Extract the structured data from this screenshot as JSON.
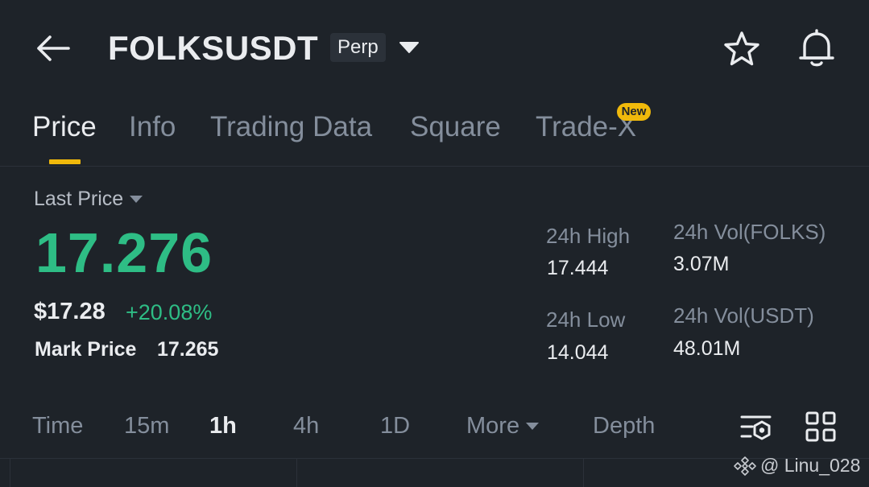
{
  "header": {
    "symbol": "FOLKSUSDT",
    "contract_type": "Perp"
  },
  "tabs": [
    {
      "label": "Price",
      "active": true
    },
    {
      "label": "Info",
      "active": false
    },
    {
      "label": "Trading Data",
      "active": false
    },
    {
      "label": "Square",
      "active": false
    },
    {
      "label": "Trade-X",
      "active": false,
      "badge": "New"
    }
  ],
  "price": {
    "label": "Last Price",
    "last_price": "17.276",
    "usd_price": "$17.28",
    "change_percent": "+20.08%",
    "mark_price_label": "Mark Price",
    "mark_price": "17.265"
  },
  "stats": {
    "high_label": "24h High",
    "high_value": "17.444",
    "low_label": "24h Low",
    "low_value": "14.044",
    "vol_base_label": "24h Vol(FOLKS)",
    "vol_base_value": "3.07M",
    "vol_quote_label": "24h Vol(USDT)",
    "vol_quote_value": "48.01M"
  },
  "intervals": [
    {
      "label": "Time",
      "active": false
    },
    {
      "label": "15m",
      "active": false
    },
    {
      "label": "1h",
      "active": true
    },
    {
      "label": "4h",
      "active": false
    },
    {
      "label": "1D",
      "active": false
    },
    {
      "label": "More",
      "active": false
    },
    {
      "label": "Depth",
      "active": false
    }
  ],
  "watermark": {
    "text": "@ Linu_028"
  },
  "colors": {
    "background": "#1e2329",
    "up_green": "#2ebd85",
    "accent_yellow": "#f0b90b",
    "muted_text": "#848e9c"
  },
  "icons": {
    "back": "back-arrow-icon",
    "dropdown": "caret-down-icon",
    "favorite": "star-icon",
    "alert": "bell-icon",
    "chart_settings": "chart-settings-icon",
    "layout": "grid-icon",
    "brand": "binance-logo-icon"
  }
}
